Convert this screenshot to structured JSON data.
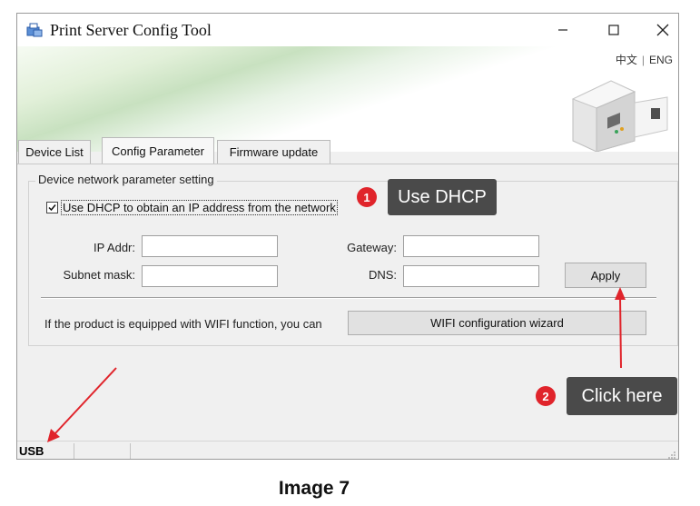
{
  "window": {
    "title": "Print Server Config Tool",
    "lang_cn": "中文",
    "lang_sep": "|",
    "lang_en": "ENG"
  },
  "tabs": [
    {
      "label": "Device List",
      "active": false
    },
    {
      "label": "Config Parameter",
      "active": true
    },
    {
      "label": "Firmware update",
      "active": false
    }
  ],
  "group": {
    "legend": "Device network parameter setting",
    "dhcp_label": "Use DHCP to obtain an IP address from the network",
    "dhcp_checked": true,
    "ip_label": "IP Addr:",
    "ip_value": "",
    "subnet_label": "Subnet mask:",
    "subnet_value": "",
    "gateway_label": "Gateway:",
    "gateway_value": "",
    "dns_label": "DNS:",
    "dns_value": "",
    "apply_label": "Apply",
    "wifi_text": "If the product is equipped with WIFI function, you can",
    "wifi_button": "WIFI configuration wizard"
  },
  "status": {
    "connection": "USB"
  },
  "annotations": {
    "callout1_number": "1",
    "callout1_text": "Use DHCP",
    "callout2_number": "2",
    "callout2_text": "Click here",
    "arrow_color": "#e0242b"
  },
  "caption": "Image 7"
}
